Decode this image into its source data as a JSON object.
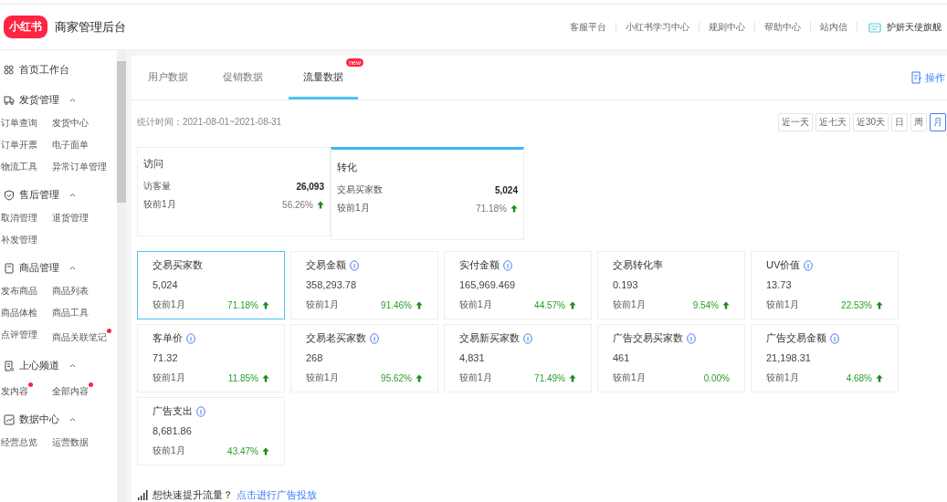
{
  "header": {
    "logo": "小红书",
    "title": "商家管理后台",
    "links": [
      "客服平台",
      "小红书学习中心",
      "规则中心",
      "帮助中心",
      "站内信"
    ],
    "store": "护妍天使旗舰"
  },
  "sidebar": {
    "home": "首页工作台",
    "groups": [
      {
        "title": "发货管理",
        "kind": "truck",
        "expanded": true,
        "items": [
          {
            "label": "订单查询",
            "dot": false
          },
          {
            "label": "发货中心",
            "dot": false
          },
          {
            "label": "订单开票",
            "dot": false
          },
          {
            "label": "电子面单",
            "dot": false
          },
          {
            "label": "物流工具",
            "dot": false
          },
          {
            "label": "异常订单管理",
            "dot": false
          }
        ]
      },
      {
        "title": "售后管理",
        "kind": "shield",
        "expanded": true,
        "items": [
          {
            "label": "取消管理",
            "dot": false
          },
          {
            "label": "退货管理",
            "dot": false
          },
          {
            "label": "补发管理",
            "dot": false
          }
        ]
      },
      {
        "title": "商品管理",
        "kind": "box",
        "expanded": true,
        "items": [
          {
            "label": "发布商品",
            "dot": false
          },
          {
            "label": "商品列表",
            "dot": false
          },
          {
            "label": "商品体检",
            "dot": false
          },
          {
            "label": "商品工具",
            "dot": false
          },
          {
            "label": "点评管理",
            "dot": false
          },
          {
            "label": "商品关联笔记",
            "dot": true
          }
        ]
      },
      {
        "title": "上心频道",
        "kind": "doc",
        "expanded": true,
        "items": [
          {
            "label": "发内容",
            "dot": true
          },
          {
            "label": "全部内容",
            "dot": true
          }
        ]
      },
      {
        "title": "数据中心",
        "kind": "chart",
        "expanded": true,
        "items": [
          {
            "label": "经营总览",
            "dot": false
          },
          {
            "label": "运营数据",
            "dot": false
          }
        ]
      }
    ]
  },
  "tabs": [
    {
      "label": "用户数据",
      "selected": false
    },
    {
      "label": "促销数据",
      "selected": false
    },
    {
      "label": "流量数据",
      "selected": true,
      "badge": "new"
    }
  ],
  "guide": "操作",
  "period": {
    "label": "统计时间：2021-08-01~2021-08-31",
    "options": [
      {
        "label": "近一天",
        "selected": false
      },
      {
        "label": "近七天",
        "selected": false
      },
      {
        "label": "近30天",
        "selected": false
      },
      {
        "label": "日",
        "selected": false
      },
      {
        "label": "周",
        "selected": false
      },
      {
        "label": "月",
        "selected": true
      }
    ]
  },
  "summary": [
    {
      "title": "访问",
      "metric": "访客量",
      "value": "26,093",
      "compare": "较前1月",
      "change": "56.26%",
      "rising": true,
      "selected": false
    },
    {
      "title": "转化",
      "metric": "交易买家数",
      "value": "5,024",
      "compare": "较前1月",
      "change": "71.18%",
      "rising": true,
      "selected": true
    }
  ],
  "metrics": [
    {
      "title": "交易买家数",
      "info": false,
      "value": "5,024",
      "compare": "较前1月",
      "change": "71.18%",
      "rising": true,
      "selected": true
    },
    {
      "title": "交易金额",
      "info": true,
      "value": "358,293.78",
      "compare": "较前1月",
      "change": "91.46%",
      "rising": true,
      "selected": false
    },
    {
      "title": "实付金额",
      "info": true,
      "value": "165,969.469",
      "compare": "较前1月",
      "change": "44.57%",
      "rising": true,
      "selected": false
    },
    {
      "title": "交易转化率",
      "info": false,
      "value": "0.193",
      "compare": "较前1月",
      "change": "9.54%",
      "rising": true,
      "selected": false
    },
    {
      "title": "UV价值",
      "info": true,
      "value": "13.73",
      "compare": "较前1月",
      "change": "22.53%",
      "rising": true,
      "selected": false
    },
    {
      "title": "客单价",
      "info": true,
      "value": "71.32",
      "compare": "较前1月",
      "change": "11.85%",
      "rising": true,
      "selected": false
    },
    {
      "title": "交易老买家数",
      "info": true,
      "value": "268",
      "compare": "较前1月",
      "change": "95.62%",
      "rising": true,
      "selected": false
    },
    {
      "title": "交易新买家数",
      "info": true,
      "value": "4,831",
      "compare": "较前1月",
      "change": "71.49%",
      "rising": true,
      "selected": false
    },
    {
      "title": "广告交易买家数",
      "info": true,
      "value": "461",
      "compare": "较前1月",
      "change": "0.00%",
      "rising": false,
      "selected": false
    },
    {
      "title": "广告交易金额",
      "info": true,
      "value": "21,198.31",
      "compare": "较前1月",
      "change": "4.68%",
      "rising": true,
      "selected": false
    },
    {
      "title": "广告支出",
      "info": true,
      "value": "8,681.86",
      "compare": "较前1月",
      "change": "43.47%",
      "rising": true,
      "selected": false
    }
  ],
  "promo": {
    "text": "想快速提升流量？",
    "link": "点击进行广告投放"
  }
}
